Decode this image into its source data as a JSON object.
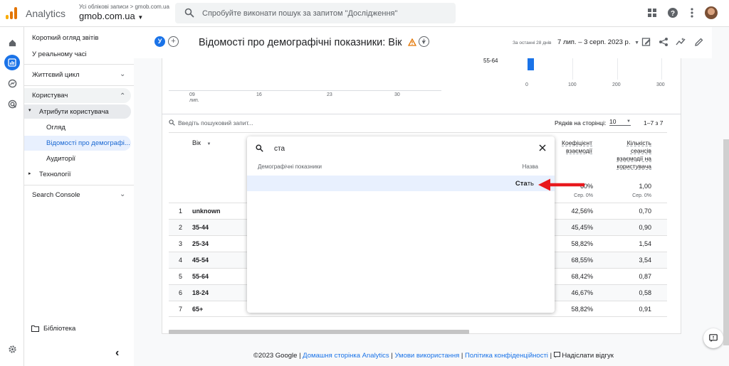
{
  "topbar": {
    "app_name": "Analytics",
    "account_crumb": "Усі облікові записи > gmob.com.ua",
    "property_name": "gmob.com.ua",
    "search_placeholder": "Спробуйте виконати пошук за запитом \"Дослідження\""
  },
  "nav": {
    "items": [
      {
        "label": "Короткий огляд звітів"
      },
      {
        "label": "У реальному часі"
      },
      {
        "label": "Життєвий цикл"
      },
      {
        "label": "Користувач"
      },
      {
        "label": "Атрибути користувача"
      },
      {
        "label": "Огляд"
      },
      {
        "label": "Відомості про демографі..."
      },
      {
        "label": "Аудиторії"
      },
      {
        "label": "Технології"
      },
      {
        "label": "Search Console"
      }
    ],
    "library": "Бібліотека",
    "collapse_glyph": "‹"
  },
  "report": {
    "segment_chip": "У",
    "title": "Відомості про демографічні показники: Вік",
    "date_prefix": "За останні 28 днів",
    "date_range": "7 лип. – 3 серп. 2023 р."
  },
  "chart_data": [
    {
      "type": "line",
      "x": [
        "09 лип.",
        "16",
        "23",
        "30"
      ],
      "series": []
    },
    {
      "type": "bar",
      "categories": [
        "55-64"
      ],
      "values": [],
      "x_ticks": [
        "0",
        "100",
        "200",
        "300"
      ]
    }
  ],
  "table": {
    "search_placeholder": "Введіть пошуковий запит...",
    "rows_per_page_label": "Рядків на сторінці:",
    "rows_per_page_value": "10",
    "pagination": "1–7 з 7",
    "dimension_header": "Вік",
    "col1_header": [
      "Коефіцієнт",
      "взаємодії"
    ],
    "col2_header": [
      "Кількість",
      "сеансів",
      "взаємодії на",
      "користувача"
    ],
    "col1_total": "60%",
    "col2_total": "1,00",
    "col1_sub": "Сер. 0%",
    "col2_sub": "Сер. 0%",
    "rows": [
      {
        "n": "1",
        "age": "unknown",
        "v1": "42,56%",
        "v2": "0,70"
      },
      {
        "n": "2",
        "age": "35-44",
        "v1": "45,45%",
        "v2": "0,90"
      },
      {
        "n": "3",
        "age": "25-34",
        "v1": "58,82%",
        "v2": "1,54"
      },
      {
        "n": "4",
        "age": "45-54",
        "v1": "68,55%",
        "v2": "3,54"
      },
      {
        "n": "5",
        "age": "55-64",
        "v1": "68,42%",
        "v2": "0,87"
      },
      {
        "n": "6",
        "age": "18-24",
        "v1": "46,67%",
        "v2": "0,58"
      },
      {
        "n": "7",
        "age": "65+",
        "v1": "58,82%",
        "v2": "0,91"
      }
    ]
  },
  "popup": {
    "query": "ста",
    "category": "Демографічні показники",
    "column": "Назва",
    "result_match": "Ста",
    "result_rest": "ть"
  },
  "footer": {
    "copyright": "©2023 Google",
    "links": [
      "Домашня сторінка Analytics",
      "Умови використання",
      "Політика конфіденційності"
    ],
    "feedback": "Надіслати відгук"
  },
  "colors": {
    "accent": "#1a73e8",
    "arrow": "#e8191d",
    "logo": [
      "#f9ab00",
      "#e37400",
      "#e37400"
    ]
  }
}
